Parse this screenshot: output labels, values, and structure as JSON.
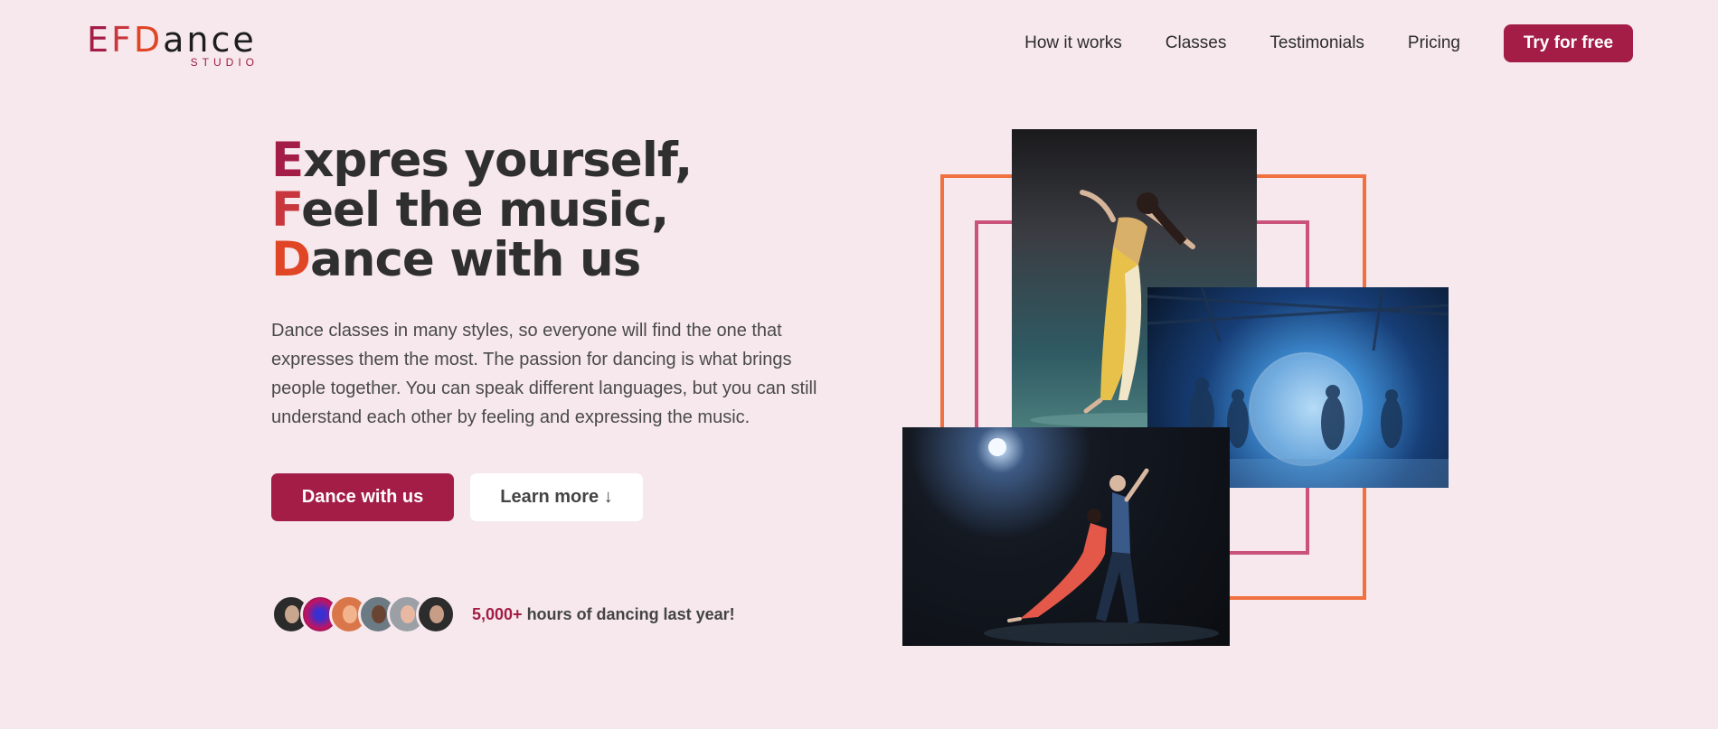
{
  "logo": {
    "letter_e": "E",
    "letter_f": "F",
    "letter_d": "D",
    "rest": "ance",
    "sub": "STUDIO"
  },
  "nav": {
    "items": [
      "How it works",
      "Classes",
      "Testimonials",
      "Pricing"
    ],
    "cta": "Try for free"
  },
  "hero": {
    "line1_initial": "E",
    "line1_rest": "xpres yourself,",
    "line2_initial": "F",
    "line2_rest": "eel the music,",
    "line3_initial": "D",
    "line3_rest": "ance with us",
    "description": "Dance classes in many styles, so everyone will find the one that expresses them the most. The passion for dancing is what brings people together. You can speak different languages, but you can still understand each other by feeling and expressing the music.",
    "primary_button": "Dance with us",
    "secondary_button": "Learn more ↓"
  },
  "social_proof": {
    "count": "5,000+",
    "text": " hours of dancing last year!"
  },
  "colors": {
    "brand": "#a31d47",
    "accent_red": "#c8373d",
    "accent_orange": "#e04526",
    "frame_orange": "#f0703f",
    "frame_pink": "#c9537b",
    "background": "#f6e8ec"
  }
}
